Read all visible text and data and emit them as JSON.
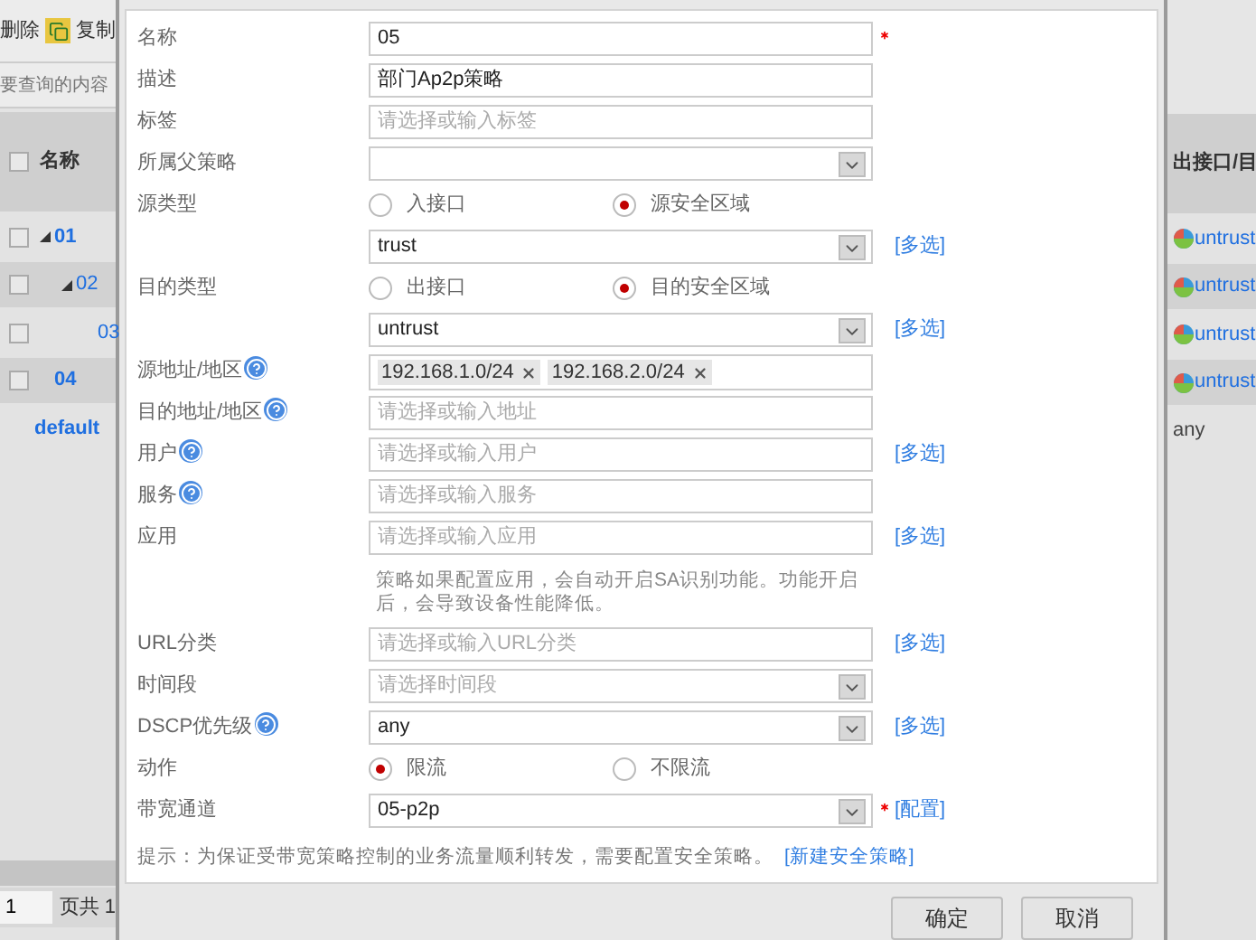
{
  "toolbar": {
    "delete_label": "删除",
    "copy_label": "复制"
  },
  "search": {
    "placeholder": "要查询的内容"
  },
  "table": {
    "columns": [
      "名称",
      "出接口/目"
    ],
    "all_checked": false,
    "rows": [
      {
        "kind": "policy",
        "name": "01",
        "checked": false,
        "expanded": true,
        "zone": "untrust",
        "children": [
          {
            "kind": "policy",
            "name": "02",
            "checked": false,
            "expanded": true,
            "zone": "untrust",
            "children": [
              {
                "kind": "policy",
                "name": "03",
                "checked": false,
                "zone": "untrust"
              }
            ]
          }
        ]
      },
      {
        "kind": "policy",
        "name": "04",
        "checked": false,
        "zone": "untrust"
      },
      {
        "kind": "default",
        "name": "default",
        "zone": "any"
      }
    ]
  },
  "pager": {
    "page": "1",
    "label": "页共 1"
  },
  "form": {
    "rows": [
      {
        "kind": "input",
        "label": "名称",
        "value": "05",
        "required": true
      },
      {
        "kind": "input",
        "label": "描述",
        "value": "部门Ap2p策略"
      },
      {
        "kind": "input",
        "label": "标签",
        "placeholder": "请选择或输入标签"
      },
      {
        "kind": "select",
        "label": "所属父策略"
      },
      {
        "kind": "radio",
        "label": "源类型",
        "options": [
          {
            "label": "入接口",
            "selected": false
          },
          {
            "label": "源安全区域",
            "selected": true
          }
        ]
      },
      {
        "kind": "select",
        "value": "trust",
        "link": "[多选]"
      },
      {
        "kind": "radio",
        "label": "目的类型",
        "options": [
          {
            "label": "出接口",
            "selected": false
          },
          {
            "label": "目的安全区域",
            "selected": true
          }
        ]
      },
      {
        "kind": "select",
        "value": "untrust",
        "link": "[多选]"
      },
      {
        "kind": "tags",
        "label": "源地址/地区",
        "help": true,
        "tags": [
          "192.168.1.0/24",
          "192.168.2.0/24"
        ]
      },
      {
        "kind": "input",
        "label": "目的地址/地区",
        "help": true,
        "placeholder": "请选择或输入地址"
      },
      {
        "kind": "input",
        "label": "用户",
        "help": true,
        "placeholder": "请选择或输入用户",
        "link": "[多选]"
      },
      {
        "kind": "input",
        "label": "服务",
        "help": true,
        "placeholder": "请选择或输入服务"
      },
      {
        "kind": "input",
        "label": "应用",
        "placeholder": "请选择或输入应用",
        "link": "[多选]"
      },
      {
        "kind": "note",
        "text": "策略如果配置应用，会自动开启SA识别功能。功能开启后，会导致设备性能降低。"
      },
      {
        "kind": "input",
        "label": "URL分类",
        "placeholder": "请选择或输入URL分类",
        "link": "[多选]"
      },
      {
        "kind": "select",
        "label": "时间段",
        "placeholder": "请选择时间段"
      },
      {
        "kind": "select",
        "label": "DSCP优先级",
        "help": true,
        "value": "any",
        "link": "[多选]"
      },
      {
        "kind": "radio",
        "label": "动作",
        "options": [
          {
            "label": "限流",
            "selected": true
          },
          {
            "label": "不限流",
            "selected": false
          }
        ]
      },
      {
        "kind": "select",
        "label": "带宽通道",
        "value": "05-p2p",
        "required": true,
        "link": "[配置]"
      }
    ]
  },
  "hint": {
    "text": "提示：为保证受带宽策略控制的业务流量顺利转发，需要配置安全策略。",
    "link": "[新建安全策略]"
  },
  "buttons": [
    "确定",
    "取消"
  ]
}
